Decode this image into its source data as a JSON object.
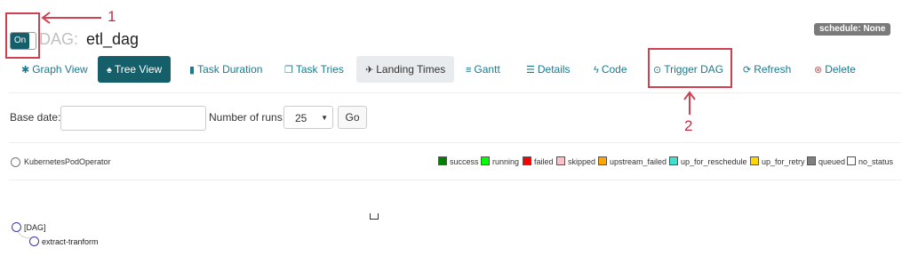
{
  "header": {
    "toggle_label": "On",
    "dag_prefix": "DAG:",
    "dag_name": "etl_dag",
    "schedule_badge": "schedule: None"
  },
  "tabs": [
    {
      "label": "Graph View",
      "icon": "asterisk-icon"
    },
    {
      "label": "Tree View",
      "icon": "tree-icon",
      "active": true
    },
    {
      "label": "Task Duration",
      "icon": "bar-chart-icon"
    },
    {
      "label": "Task Tries",
      "icon": "duplicate-icon"
    },
    {
      "label": "Landing Times",
      "icon": "plane-icon"
    },
    {
      "label": "Gantt",
      "icon": "align-left-icon"
    },
    {
      "label": "Details",
      "icon": "list-icon"
    },
    {
      "label": "Code",
      "icon": "flash-icon"
    },
    {
      "label": "Trigger DAG",
      "icon": "play-circle-icon"
    },
    {
      "label": "Refresh",
      "icon": "refresh-icon"
    },
    {
      "label": "Delete",
      "icon": "remove-circle-icon"
    }
  ],
  "controls": {
    "base_date_label": "Base date:",
    "base_date_value": "",
    "num_runs_label": "Number of runs:",
    "num_runs_value": "25",
    "go_label": "Go"
  },
  "operator_legend": {
    "label": "KubernetesPodOperator"
  },
  "state_legend": [
    {
      "label": "success",
      "color": "#008000"
    },
    {
      "label": "running",
      "color": "#00ff00"
    },
    {
      "label": "failed",
      "color": "#ff0000"
    },
    {
      "label": "skipped",
      "color": "#ffc0cb"
    },
    {
      "label": "upstream_failed",
      "color": "#ffa500"
    },
    {
      "label": "up_for_reschedule",
      "color": "#40e0d0"
    },
    {
      "label": "up_for_retry",
      "color": "#ffd700"
    },
    {
      "label": "queued",
      "color": "#808080"
    },
    {
      "label": "no_status",
      "color": "#ffffff"
    }
  ],
  "tree": {
    "root": "[DAG]",
    "child": "extract-tranform"
  },
  "annotations": {
    "marker_1": "1",
    "marker_2": "2",
    "accent": "#d04050"
  }
}
